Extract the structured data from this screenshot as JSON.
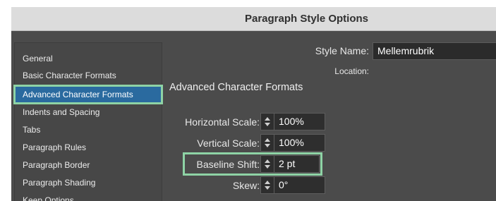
{
  "dialog": {
    "title": "Paragraph Style Options"
  },
  "sidebar": {
    "items": [
      {
        "label": "General"
      },
      {
        "label": "Basic Character Formats"
      },
      {
        "label": "Advanced Character Formats"
      },
      {
        "label": "Indents and Spacing"
      },
      {
        "label": "Tabs"
      },
      {
        "label": "Paragraph Rules"
      },
      {
        "label": "Paragraph Border"
      },
      {
        "label": "Paragraph Shading"
      },
      {
        "label": "Keep Options"
      }
    ],
    "selected_index": 2
  },
  "header": {
    "style_name_label": "Style Name:",
    "style_name_value": "Mellemrubrik",
    "location_label": "Location:"
  },
  "section": {
    "heading": "Advanced Character Formats",
    "fields": [
      {
        "label": "Horizontal Scale:",
        "value": "100%"
      },
      {
        "label": "Vertical Scale:",
        "value": "100%"
      },
      {
        "label": "Baseline Shift:",
        "value": "2 pt"
      },
      {
        "label": "Skew:",
        "value": "0°"
      }
    ]
  },
  "colors": {
    "highlight": "#8ed3a5",
    "selection": "#2a6a9f",
    "panel": "#4b4b4b"
  }
}
